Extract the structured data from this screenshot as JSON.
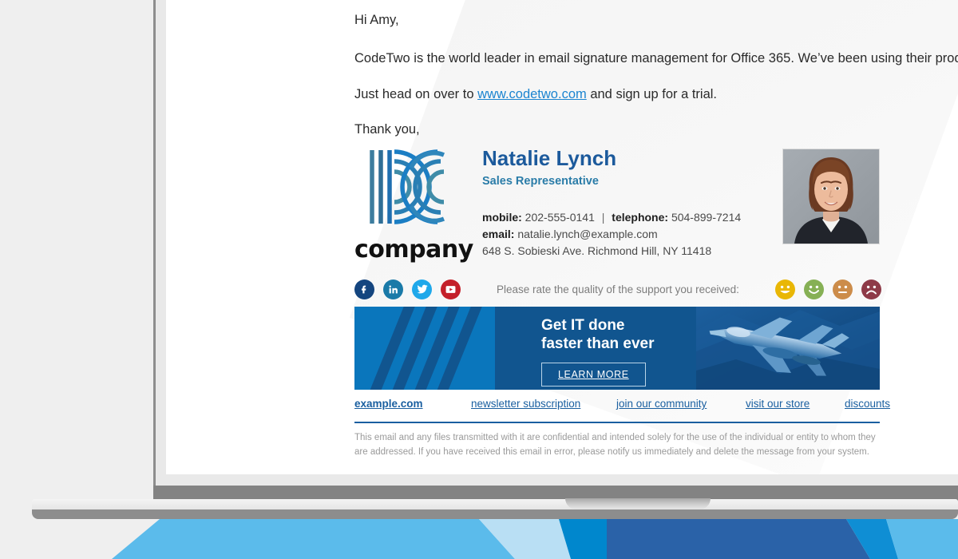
{
  "email": {
    "greeting": "Hi Amy,",
    "body_line1_before_link": "CodeTwo is the world leader in email signature management for Office 365. We’ve been using their products for years.",
    "body_line2_before_link": "Just head on over to ",
    "body_link": "www.codetwo.com",
    "body_line2_after_link": " and sign up for a trial.",
    "closing": "Thank you,"
  },
  "signature": {
    "logo_wordmark": "company",
    "logo_icon": "company-logo-icon",
    "name": "Natalie Lynch",
    "title": "Sales Representative",
    "mobile_label": "mobile:",
    "mobile_value": "202-555-0141",
    "separator": "|",
    "telephone_label": "telephone:",
    "telephone_value": "504-899-7214",
    "email_label": "email:",
    "email_value": "natalie.lynch@example.com",
    "address": "648 S. Sobieski Ave. Richmond Hill, NY 11418",
    "photo_alt": "portrait-photo"
  },
  "social": {
    "items": [
      {
        "name": "facebook-icon",
        "glyph": "f",
        "color": "#14457f"
      },
      {
        "name": "linkedin-icon",
        "glyph": "in",
        "color": "#1a7aa8"
      },
      {
        "name": "twitter-icon",
        "glyph": "t",
        "color": "#1fa8ea"
      },
      {
        "name": "youtube-icon",
        "glyph": "You Tube",
        "color": "#c4202a"
      }
    ]
  },
  "rating": {
    "prompt": "Please rate the quality of the support you received:",
    "faces": [
      {
        "name": "face-very-happy-icon",
        "color": "#e9b706"
      },
      {
        "name": "face-happy-icon",
        "color": "#86b055"
      },
      {
        "name": "face-neutral-icon",
        "color": "#cc8c4a"
      },
      {
        "name": "face-sad-icon",
        "color": "#8e3a48"
      }
    ]
  },
  "banner": {
    "headline_line1": "Get IT done",
    "headline_line2": "faster than ever",
    "cta_label": "LEARN MORE",
    "image_alt": "fighter-jet-photo",
    "bg_dark": "#11558f",
    "bg_light": "#0a76bc"
  },
  "footer": {
    "links": [
      "example.com",
      "newsletter subscription",
      "join our community",
      "visit our store",
      "discounts"
    ],
    "accent_color": "#1a5fa0"
  },
  "disclaimer": {
    "text": "This email and any files transmitted with it are confidential and intended solely for the use of the individual or entity to whom they are addressed. If you have received this email in error, please notify us immediately and delete the message from your system."
  },
  "device": {
    "name": "laptop-mockup"
  },
  "background": {
    "page_color": "#efefef",
    "shape_colors": [
      "#5bbbeb",
      "#b9dff4",
      "#0087cd",
      "#2a62a8",
      "#0f8ed4",
      "#5bbbeb"
    ]
  }
}
